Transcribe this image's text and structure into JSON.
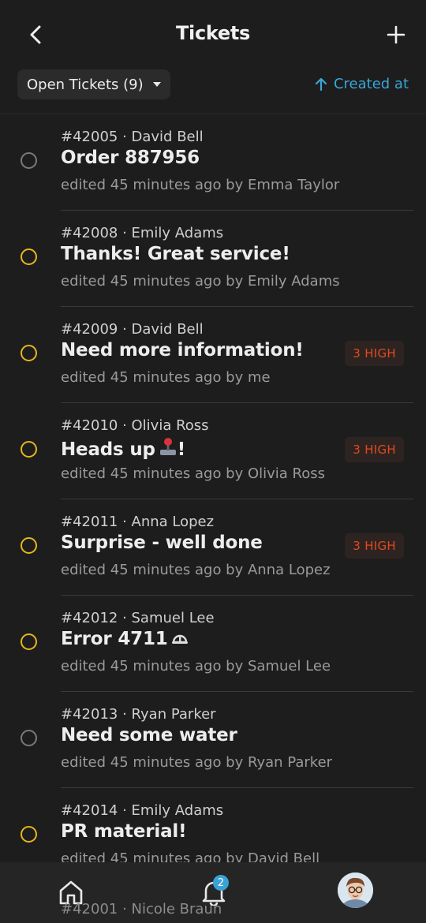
{
  "header": {
    "title": "Tickets"
  },
  "filter": {
    "label": "Open Tickets (9)",
    "sort_label": "Created at"
  },
  "tickets": [
    {
      "meta": "#42005 · David Bell",
      "subject": "Order 887956",
      "edited": "edited 45 minutes ago by Emma Taylor",
      "status": "new",
      "priority": ""
    },
    {
      "meta": "#42008 · Emily Adams",
      "subject": "Thanks! Great service!",
      "edited": "edited 45 minutes ago by Emily Adams",
      "status": "pending",
      "priority": ""
    },
    {
      "meta": "#42009 · David Bell",
      "subject": "Need more information!",
      "edited": "edited 45 minutes ago by me",
      "status": "pending",
      "priority": "3 HIGH"
    },
    {
      "meta": "#42010 · Olivia Ross",
      "subject": "Heads up",
      "subject_suffix": "!",
      "emoji": "joystick-icon",
      "edited": "edited 45 minutes ago by Olivia Ross",
      "status": "pending",
      "priority": "3 HIGH"
    },
    {
      "meta": "#42011 · Anna Lopez",
      "subject": "Surprise - well done",
      "edited": "edited 45 minutes ago by Anna Lopez",
      "status": "pending",
      "priority": "3 HIGH"
    },
    {
      "meta": "#42012 · Samuel Lee",
      "subject": "Error 4711",
      "emoji": "helmet-icon",
      "edited": "edited 45 minutes ago by Samuel Lee",
      "status": "pending",
      "priority": ""
    },
    {
      "meta": "#42013 · Ryan Parker",
      "subject": "Need some water",
      "edited": "edited 45 minutes ago by Ryan Parker",
      "status": "new",
      "priority": ""
    },
    {
      "meta": "#42014 · Emily Adams",
      "subject": "PR material!",
      "edited": "edited 45 minutes ago by David Bell",
      "status": "pending",
      "priority": ""
    }
  ],
  "peek_ticket": {
    "meta": "#42001 · Nicole Braun"
  },
  "tabbar": {
    "notification_count": "2"
  },
  "colors": {
    "background": "#1d1d1d",
    "accent": "#39a6d8",
    "pending": "#e5b71a",
    "high_priority": "#e3481f"
  }
}
